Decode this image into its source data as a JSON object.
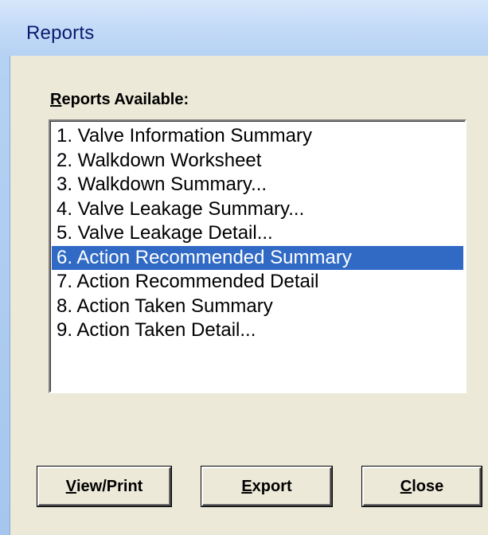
{
  "window": {
    "title": "Reports"
  },
  "group": {
    "label_accel": "R",
    "label_rest": "eports Available:"
  },
  "reports": [
    {
      "label": "1. Valve Information Summary",
      "selected": false
    },
    {
      "label": "2. Walkdown Worksheet",
      "selected": false
    },
    {
      "label": "3. Walkdown Summary...",
      "selected": false
    },
    {
      "label": "4. Valve Leakage Summary...",
      "selected": false
    },
    {
      "label": "5. Valve Leakage Detail...",
      "selected": false
    },
    {
      "label": "6. Action Recommended Summary",
      "selected": true
    },
    {
      "label": "7. Action Recommended Detail",
      "selected": false
    },
    {
      "label": "8. Action Taken Summary",
      "selected": false
    },
    {
      "label": "9. Action Taken Detail...",
      "selected": false
    }
  ],
  "buttons": {
    "view_print": {
      "accel": "V",
      "rest": "iew/Print"
    },
    "export": {
      "accel": "E",
      "rest": "xport"
    },
    "close": {
      "accel": "C",
      "rest": "lose"
    }
  },
  "colors": {
    "selection": "#316ac5",
    "dialog_face": "#ece9d8",
    "title_text": "#0b1a6e"
  }
}
